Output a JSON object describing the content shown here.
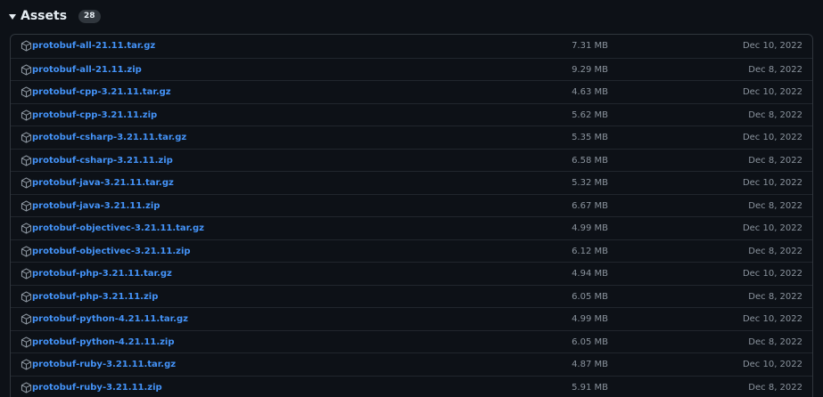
{
  "header": {
    "title": "Assets",
    "count": "28"
  },
  "assets": [
    {
      "name": "protobuf-all-21.11.tar.gz",
      "size": "7.31 MB",
      "date": "Dec 10, 2022"
    },
    {
      "name": "protobuf-all-21.11.zip",
      "size": "9.29 MB",
      "date": "Dec 8, 2022"
    },
    {
      "name": "protobuf-cpp-3.21.11.tar.gz",
      "size": "4.63 MB",
      "date": "Dec 10, 2022"
    },
    {
      "name": "protobuf-cpp-3.21.11.zip",
      "size": "5.62 MB",
      "date": "Dec 8, 2022"
    },
    {
      "name": "protobuf-csharp-3.21.11.tar.gz",
      "size": "5.35 MB",
      "date": "Dec 10, 2022"
    },
    {
      "name": "protobuf-csharp-3.21.11.zip",
      "size": "6.58 MB",
      "date": "Dec 8, 2022"
    },
    {
      "name": "protobuf-java-3.21.11.tar.gz",
      "size": "5.32 MB",
      "date": "Dec 10, 2022"
    },
    {
      "name": "protobuf-java-3.21.11.zip",
      "size": "6.67 MB",
      "date": "Dec 8, 2022"
    },
    {
      "name": "protobuf-objectivec-3.21.11.tar.gz",
      "size": "4.99 MB",
      "date": "Dec 10, 2022"
    },
    {
      "name": "protobuf-objectivec-3.21.11.zip",
      "size": "6.12 MB",
      "date": "Dec 8, 2022"
    },
    {
      "name": "protobuf-php-3.21.11.tar.gz",
      "size": "4.94 MB",
      "date": "Dec 10, 2022"
    },
    {
      "name": "protobuf-php-3.21.11.zip",
      "size": "6.05 MB",
      "date": "Dec 8, 2022"
    },
    {
      "name": "protobuf-python-4.21.11.tar.gz",
      "size": "4.99 MB",
      "date": "Dec 10, 2022"
    },
    {
      "name": "protobuf-python-4.21.11.zip",
      "size": "6.05 MB",
      "date": "Dec 8, 2022"
    },
    {
      "name": "protobuf-ruby-3.21.11.tar.gz",
      "size": "4.87 MB",
      "date": "Dec 10, 2022"
    },
    {
      "name": "protobuf-ruby-3.21.11.zip",
      "size": "5.91 MB",
      "date": "Dec 8, 2022"
    }
  ],
  "icons": {
    "caret": "triangle-down-icon",
    "asset": "package-icon"
  },
  "colors": {
    "background": "#0d1117",
    "link": "#4493f8",
    "muted": "#8b949e",
    "border": "#30363d"
  }
}
